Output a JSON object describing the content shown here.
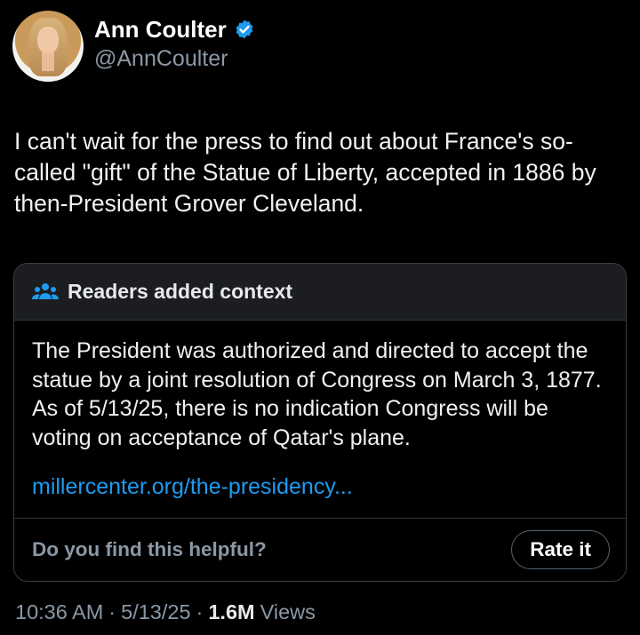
{
  "author": {
    "display_name": "Ann Coulter",
    "handle": "@AnnCoulter",
    "verified": true,
    "verified_color": "#1d9bf0"
  },
  "tweet": {
    "text": "I can't wait for the press to find out about France's so-called \"gift\" of the Statue of Liberty, accepted in 1886 by then-President Grover Cleveland."
  },
  "community_note": {
    "header_icon": "people-icon",
    "header_title": "Readers added context",
    "body": "The President was authorized and directed to accept the statue by a joint resolution of Congress on March 3, 1877. As of 5/13/25, there is no indication Congress will be voting on acceptance of Qatar's plane.",
    "link_text": "millercenter.org/the-presidency...",
    "helpful_question": "Do you find this helpful?",
    "rate_button": "Rate it"
  },
  "meta": {
    "time": "10:36 AM",
    "separator": "·",
    "date": "5/13/25",
    "views_count": "1.6M",
    "views_label": "Views"
  },
  "colors": {
    "background": "#000000",
    "text": "#e7e9ea",
    "secondary": "#8b98a5",
    "link": "#1d9bf0"
  }
}
